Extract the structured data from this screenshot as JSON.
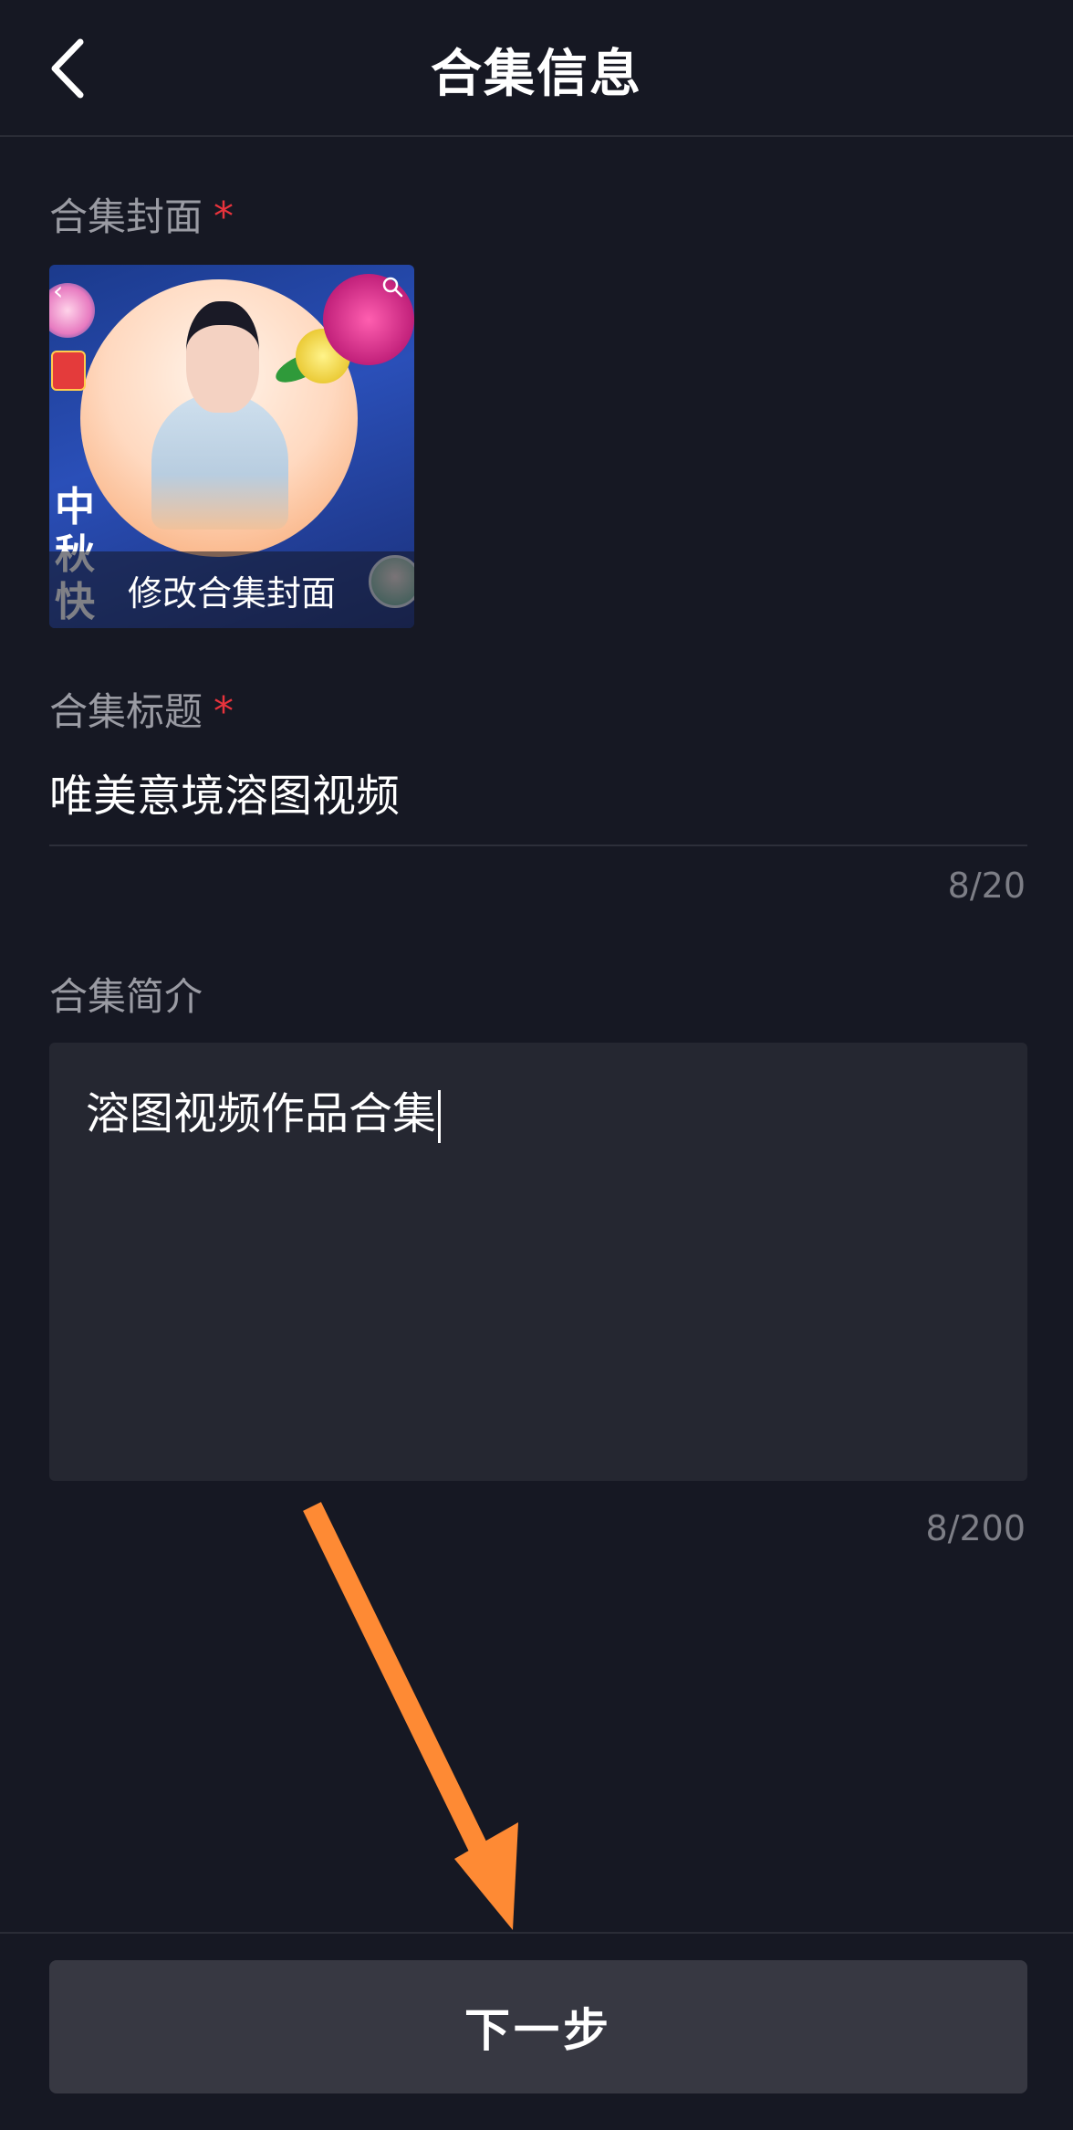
{
  "header": {
    "title": "合集信息"
  },
  "cover_section": {
    "label": "合集封面",
    "required_mark": "*",
    "edit_label": "修改合集封面",
    "calligraphy": "中秋快乐"
  },
  "title_section": {
    "label": "合集标题",
    "required_mark": "*",
    "value": "唯美意境溶图视频",
    "counter": "8/20"
  },
  "description_section": {
    "label": "合集简介",
    "value": "溶图视频作品合集",
    "counter": "8/200"
  },
  "footer": {
    "next_label": "下一步"
  },
  "colors": {
    "background": "#161823",
    "required": "#e8333c",
    "arrow": "#fe8a34",
    "button": "#373842"
  }
}
